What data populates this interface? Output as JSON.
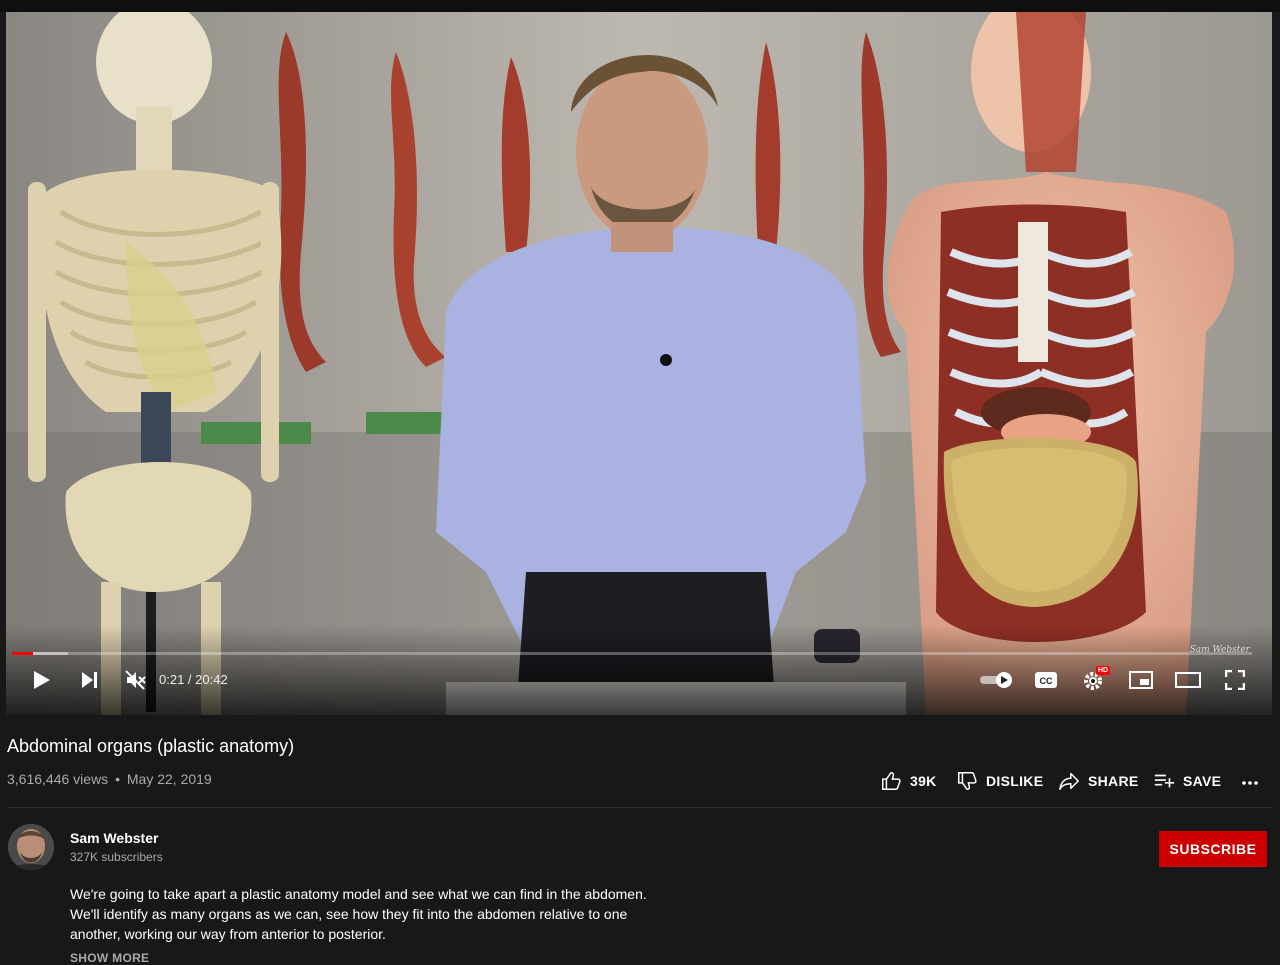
{
  "player": {
    "watermark": "Sam Webster",
    "current_time": "0:21",
    "duration": "20:42",
    "time_display": "0:21 / 20:42",
    "progress_played": 0.017,
    "progress_buffered": 0.045,
    "hd_badge": "HD",
    "muted": true
  },
  "video": {
    "title": "Abdominal organs (plastic anatomy)",
    "views": "3,616,446 views",
    "separator": "•",
    "date": "May 22, 2019"
  },
  "actions": {
    "like_count": "39K",
    "dislike_label": "DISLIKE",
    "share_label": "SHARE",
    "save_label": "SAVE"
  },
  "channel": {
    "name": "Sam Webster",
    "subscribers": "327K subscribers",
    "subscribe_label": "SUBSCRIBE"
  },
  "description": {
    "text": "We're going to take apart a plastic anatomy model and see what we can find in the abdomen. We'll identify as many organs as we can, see how they fit into the abdomen relative to one another, working our way from anterior to posterior.",
    "show_more": "SHOW MORE"
  },
  "colors": {
    "background": "#181818",
    "accent": "#ff0000",
    "subscribe": "#cc0000",
    "secondary_text": "#aaaaaa"
  },
  "icons": [
    "play-icon",
    "next-icon",
    "volume-muted-icon",
    "autoplay-toggle-icon",
    "captions-icon",
    "settings-icon",
    "miniplayer-icon",
    "theater-icon",
    "fullscreen-icon",
    "thumbs-up-icon",
    "thumbs-down-icon",
    "share-icon",
    "save-playlist-icon",
    "more-icon"
  ]
}
